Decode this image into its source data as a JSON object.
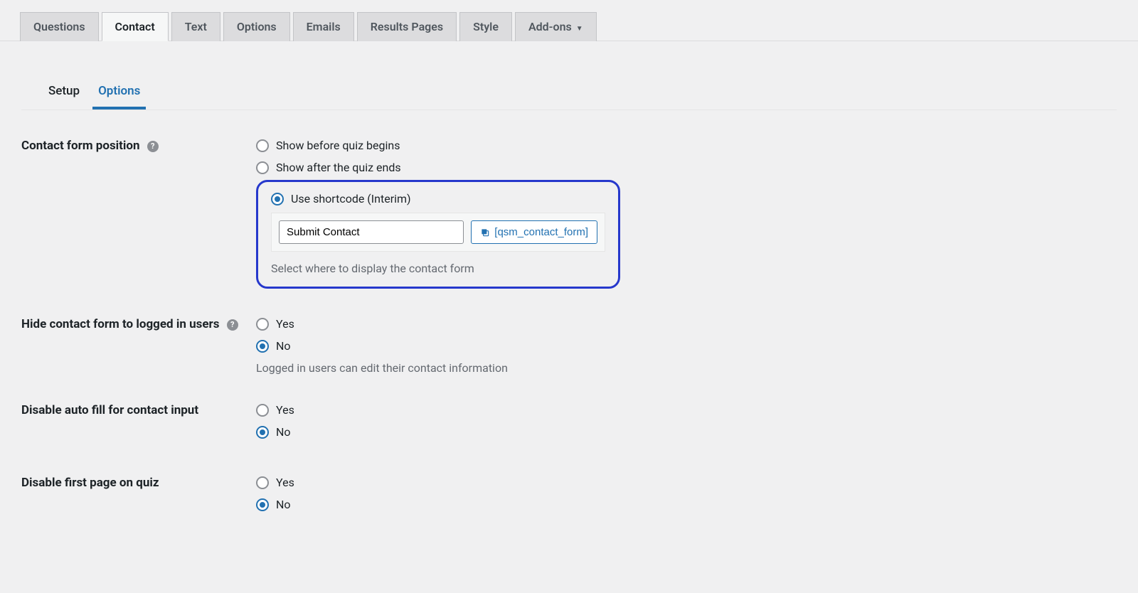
{
  "mainTabs": {
    "questions": "Questions",
    "contact": "Contact",
    "text": "Text",
    "options": "Options",
    "emails": "Emails",
    "resultsPages": "Results Pages",
    "style": "Style",
    "addons": "Add-ons"
  },
  "subTabs": {
    "setup": "Setup",
    "options": "Options"
  },
  "fields": {
    "contactFormPosition": {
      "label": "Contact form position",
      "options": {
        "before": "Show before quiz begins",
        "after": "Show after the quiz ends",
        "shortcode": "Use shortcode (Interim)"
      },
      "inputValue": "Submit Contact",
      "shortcodeLabel": "[qsm_contact_form]",
      "description": "Select where to display the contact form"
    },
    "hideContactLoggedIn": {
      "label": "Hide contact form to logged in users",
      "options": {
        "yes": "Yes",
        "no": "No"
      },
      "description": "Logged in users can edit their contact information"
    },
    "disableAutofill": {
      "label": "Disable auto fill for contact input",
      "options": {
        "yes": "Yes",
        "no": "No"
      }
    },
    "disableFirstPage": {
      "label": "Disable first page on quiz",
      "options": {
        "yes": "Yes",
        "no": "No"
      }
    }
  }
}
